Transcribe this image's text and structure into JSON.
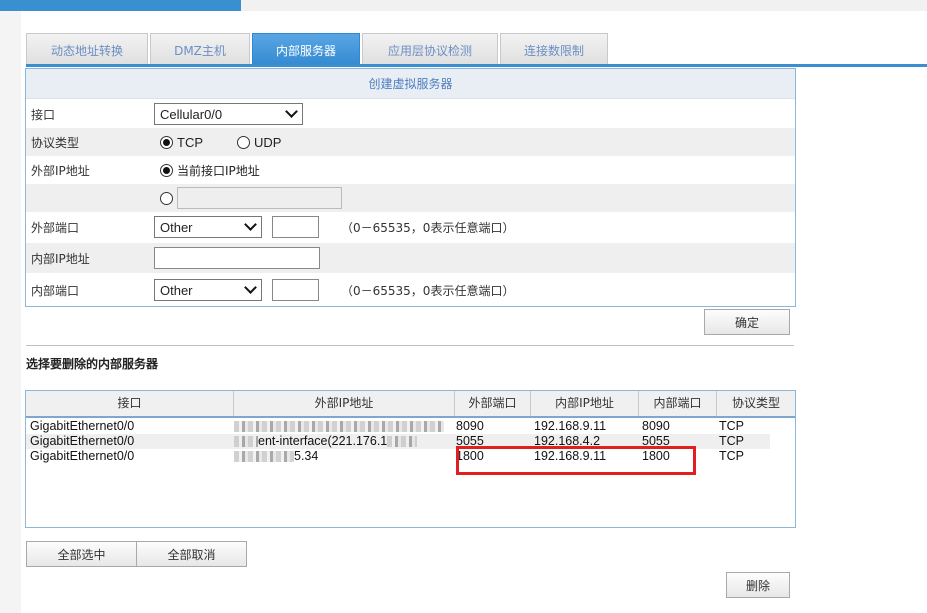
{
  "tabs": [
    {
      "label": "动态地址转换",
      "active": false
    },
    {
      "label": "DMZ主机",
      "active": false
    },
    {
      "label": "内部服务器",
      "active": true
    },
    {
      "label": "应用层协议检测",
      "active": false
    },
    {
      "label": "连接数限制",
      "active": false
    }
  ],
  "form": {
    "title": "创建虚拟服务器",
    "interface": {
      "label": "接口",
      "value": "Cellular0/0"
    },
    "protocol": {
      "label": "协议类型",
      "options": [
        "TCP",
        "UDP"
      ],
      "selected": "TCP"
    },
    "external_ip": {
      "label": "外部IP地址",
      "option_current": "当前接口IP地址",
      "custom_value": ""
    },
    "external_port": {
      "label": "外部端口",
      "value": "Other",
      "input_value": "",
      "hint": "（0－65535，0表示任意端口）"
    },
    "internal_ip": {
      "label": "内部IP地址",
      "value": ""
    },
    "internal_port": {
      "label": "内部端口",
      "value": "Other",
      "input_value": "",
      "hint": "（0－65535，0表示任意端口）"
    },
    "confirm_label": "确定"
  },
  "list": {
    "title": "选择要删除的内部服务器",
    "columns": [
      "接口",
      "外部IP地址",
      "外部端口",
      "内部IP地址",
      "内部端口",
      "协议类型"
    ],
    "rows": [
      {
        "interface": "GigabitEthernet0/0",
        "external_ip": "",
        "external_port": "8090",
        "internal_ip": "192.168.9.11",
        "internal_port": "8090",
        "protocol": "TCP"
      },
      {
        "interface": "GigabitEthernet0/0",
        "external_ip": "ent-interface(221.176.1",
        "external_port": "5055",
        "internal_ip": "192.168.4.2",
        "internal_port": "5055",
        "protocol": "TCP"
      },
      {
        "interface": "GigabitEthernet0/0",
        "external_ip": "5.34",
        "external_port": "1800",
        "internal_ip": "192.168.9.11",
        "internal_port": "1800",
        "protocol": "TCP"
      }
    ]
  },
  "buttons": {
    "select_all": "全部选中",
    "deselect_all": "全部取消",
    "delete": "删除"
  },
  "colors": {
    "accent": "#3a8fd0",
    "highlight": "#e02020"
  }
}
